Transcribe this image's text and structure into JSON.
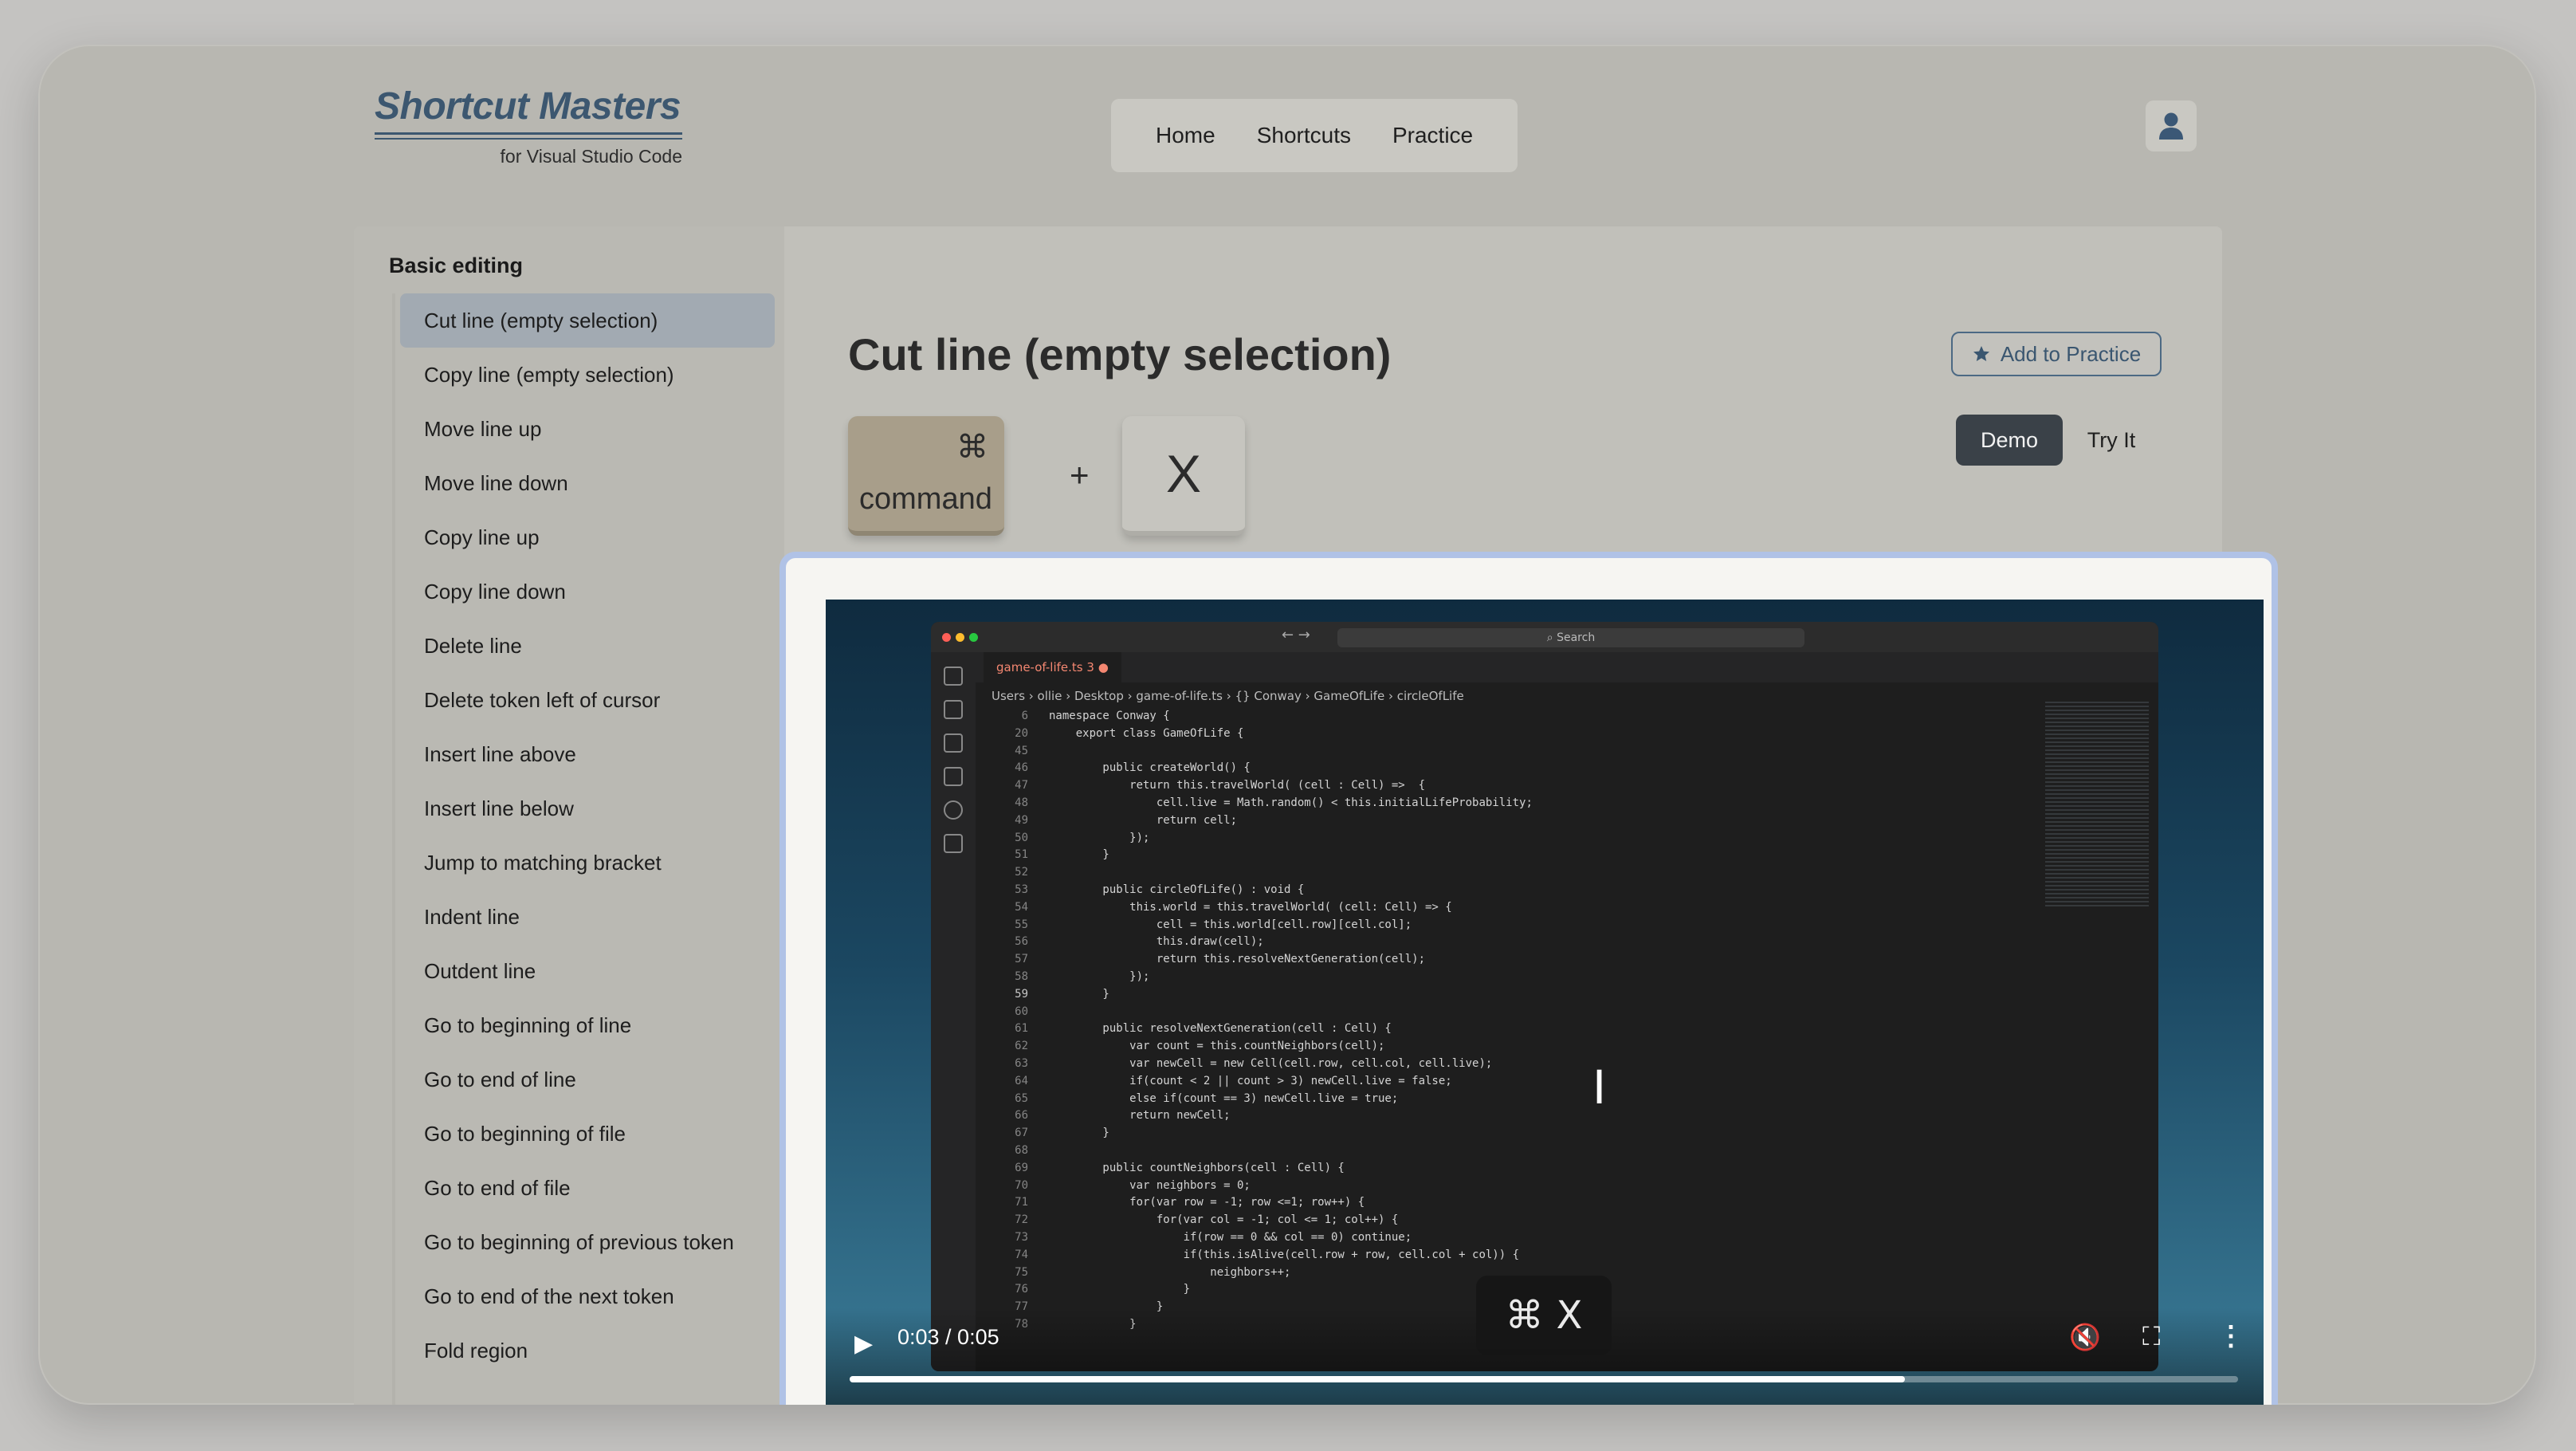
{
  "header": {
    "logo_title": "Shortcut Masters",
    "logo_subtitle": "for Visual Studio Code",
    "nav": [
      {
        "label": "Home"
      },
      {
        "label": "Shortcuts"
      },
      {
        "label": "Practice"
      }
    ]
  },
  "sidebar": {
    "heading": "Basic editing",
    "active_index": 0,
    "items": [
      {
        "label": "Cut line (empty selection)"
      },
      {
        "label": "Copy line (empty selection)"
      },
      {
        "label": "Move line up"
      },
      {
        "label": "Move line down"
      },
      {
        "label": "Copy line up"
      },
      {
        "label": "Copy line down"
      },
      {
        "label": "Delete line"
      },
      {
        "label": "Delete token left of cursor"
      },
      {
        "label": "Insert line above"
      },
      {
        "label": "Insert line below"
      },
      {
        "label": "Jump to matching bracket"
      },
      {
        "label": "Indent line"
      },
      {
        "label": "Outdent line"
      },
      {
        "label": "Go to beginning of line"
      },
      {
        "label": "Go to end of line"
      },
      {
        "label": "Go to beginning of file"
      },
      {
        "label": "Go to end of file"
      },
      {
        "label": "Go to beginning of previous token"
      },
      {
        "label": "Go to end of the next token"
      },
      {
        "label": "Fold region"
      }
    ]
  },
  "shortcut": {
    "title": "Cut line (empty selection)",
    "add_to_practice": "Add to Practice",
    "key1_symbol": "⌘",
    "key1_label": "command",
    "plus": "+",
    "key2_label": "X",
    "mode_demo": "Demo",
    "mode_try": "Try It"
  },
  "video": {
    "time": "0:03 / 0:05",
    "progress": 0.76,
    "overlay_symbol": "⌘",
    "overlay_key": "X",
    "editor": {
      "search": "Search",
      "tab": "game-of-life.ts 3",
      "breadcrumb": "Users › ollie › Desktop › game-of-life.ts › {} Conway › GameOfLife › circleOfLife",
      "code_lines": [
        {
          "n": "6",
          "t": "namespace Conway {"
        },
        {
          "n": "20",
          "t": "    export class GameOfLife {"
        },
        {
          "n": "45",
          "t": ""
        },
        {
          "n": "46",
          "t": "        public createWorld() {"
        },
        {
          "n": "47",
          "t": "            return this.travelWorld( (cell : Cell) =>  {"
        },
        {
          "n": "48",
          "t": "                cell.live = Math.random() < this.initialLifeProbability;"
        },
        {
          "n": "49",
          "t": "                return cell;"
        },
        {
          "n": "50",
          "t": "            });"
        },
        {
          "n": "51",
          "t": "        }"
        },
        {
          "n": "52",
          "t": ""
        },
        {
          "n": "53",
          "t": "        public circleOfLife() : void {"
        },
        {
          "n": "54",
          "t": "            this.world = this.travelWorld( (cell: Cell) => {"
        },
        {
          "n": "55",
          "t": "                cell = this.world[cell.row][cell.col];"
        },
        {
          "n": "56",
          "t": "                this.draw(cell);"
        },
        {
          "n": "57",
          "t": "                return this.resolveNextGeneration(cell);"
        },
        {
          "n": "58",
          "t": "            });"
        },
        {
          "n": "59",
          "t": "        }"
        },
        {
          "n": "60",
          "t": ""
        },
        {
          "n": "61",
          "t": "        public resolveNextGeneration(cell : Cell) {"
        },
        {
          "n": "62",
          "t": "            var count = this.countNeighbors(cell);"
        },
        {
          "n": "63",
          "t": "            var newCell = new Cell(cell.row, cell.col, cell.live);"
        },
        {
          "n": "64",
          "t": "            if(count < 2 || count > 3) newCell.live = false;"
        },
        {
          "n": "65",
          "t": "            else if(count == 3) newCell.live = true;"
        },
        {
          "n": "66",
          "t": "            return newCell;"
        },
        {
          "n": "67",
          "t": "        }"
        },
        {
          "n": "68",
          "t": ""
        },
        {
          "n": "69",
          "t": "        public countNeighbors(cell : Cell) {"
        },
        {
          "n": "70",
          "t": "            var neighbors = 0;"
        },
        {
          "n": "71",
          "t": "            for(var row = -1; row <=1; row++) {"
        },
        {
          "n": "72",
          "t": "                for(var col = -1; col <= 1; col++) {"
        },
        {
          "n": "73",
          "t": "                    if(row == 0 && col == 0) continue;"
        },
        {
          "n": "74",
          "t": "                    if(this.isAlive(cell.row + row, cell.col + col)) {"
        },
        {
          "n": "75",
          "t": "                        neighbors++;"
        },
        {
          "n": "76",
          "t": "                    }"
        },
        {
          "n": "77",
          "t": "                }"
        },
        {
          "n": "78",
          "t": "            }"
        }
      ]
    }
  }
}
